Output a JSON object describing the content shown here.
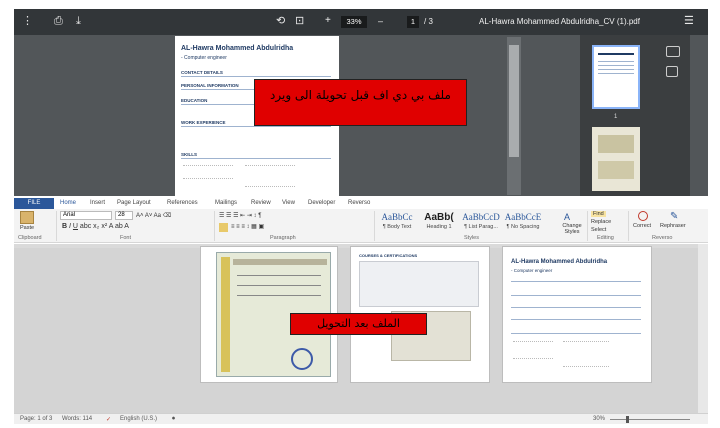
{
  "pdf_viewer": {
    "file_title": "AL-Hawra Mohammed Abdulridha_CV (1).pdf",
    "page_current": "1",
    "page_total": "/ 3",
    "zoom": "33%",
    "zoom_minus": "–",
    "zoom_plus": "+",
    "thumb1_num": "1",
    "page_preview": {
      "name": "AL-Hawra Mohammed Abdulridha",
      "subtitle": "- Computer engineer",
      "sections": [
        "CONTACT DETAILS",
        "PERSONAL INFORMATION",
        "EDUCATION",
        "WORK EXPERIENCE",
        "SKILLS"
      ]
    }
  },
  "note_before": "ملف بي دي اف قبل تحويلة الى ويرد",
  "note_after": "الملف بعد التحويل",
  "word": {
    "file_tab": "FILE",
    "tabs": [
      "Home",
      "Insert",
      "Page Layout",
      "References",
      "Mailings",
      "Review",
      "View",
      "Developer",
      "Reverso"
    ],
    "font_name": "Arial",
    "font_size": "28",
    "paste_label": "Paste",
    "groups": [
      "Clipboard",
      "Font",
      "Paragraph",
      "Styles",
      "Editing",
      "Reverso"
    ],
    "styles": [
      {
        "preview": "AaBbCc",
        "label": "¶ Body Text"
      },
      {
        "preview": "AaBb(",
        "label": "Heading 1"
      },
      {
        "preview": "AaBbCcD",
        "label": "¶ List Parag..."
      },
      {
        "preview": "AaBbCcE",
        "label": "¶ No Spacing"
      }
    ],
    "change_styles": "Change Styles",
    "find_label": "Find",
    "replace_label": "Replace",
    "select_label": "Select",
    "correct_label": "Correct",
    "rephraser_label": "Rephraser",
    "doc_page3": {
      "name": "AL-Hawra Mohammed Abdulridha",
      "subtitle": "- Computer engineer"
    },
    "doc_page2_header": "COURSES & CERTIFICATIONS",
    "status": {
      "page": "Page: 1 of 3",
      "words": "Words: 114",
      "language": "English (U.S.)",
      "zoom": "30%"
    }
  },
  "colors": {
    "pdf_bg": "#525659",
    "pdf_toolbar": "#323639",
    "word_blue": "#2b579a",
    "note_red": "#e00000"
  }
}
